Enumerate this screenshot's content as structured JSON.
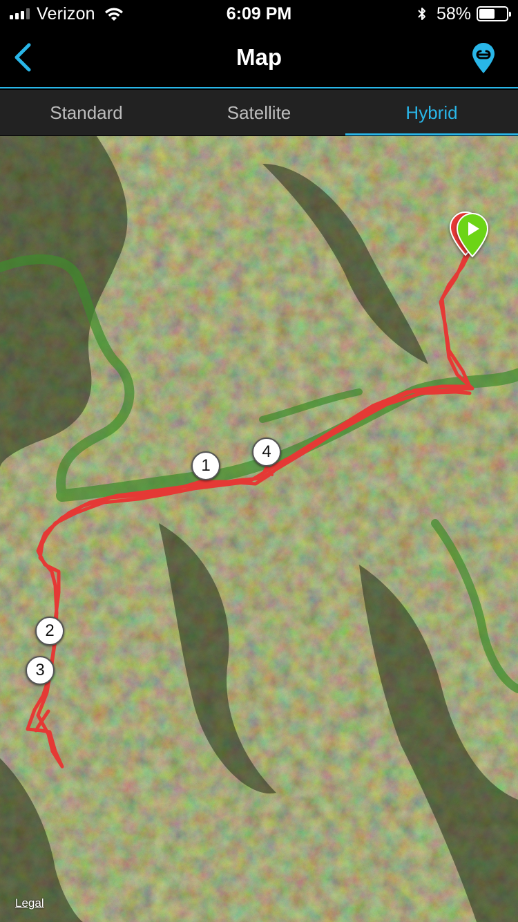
{
  "status_bar": {
    "carrier": "Verizon",
    "time": "6:09 PM",
    "battery_percent": "58%",
    "battery_level": 0.58,
    "signal_bars": 3,
    "signal_bars_total": 4
  },
  "nav": {
    "title": "Map",
    "back_icon": "chevron-left-icon",
    "right_icon": "route-pin-icon"
  },
  "tabs": [
    {
      "label": "Standard",
      "active": false
    },
    {
      "label": "Satellite",
      "active": false
    },
    {
      "label": "Hybrid",
      "active": true
    }
  ],
  "map": {
    "lap_markers": [
      "1",
      "2",
      "3",
      "4"
    ],
    "legal": "Legal",
    "track_color": "#e53935",
    "start_color": "#6cd416",
    "end_color": "#e53935"
  },
  "colors": {
    "accent": "#29b6e8",
    "nav_background": "#000000",
    "tab_background": "#222222"
  }
}
